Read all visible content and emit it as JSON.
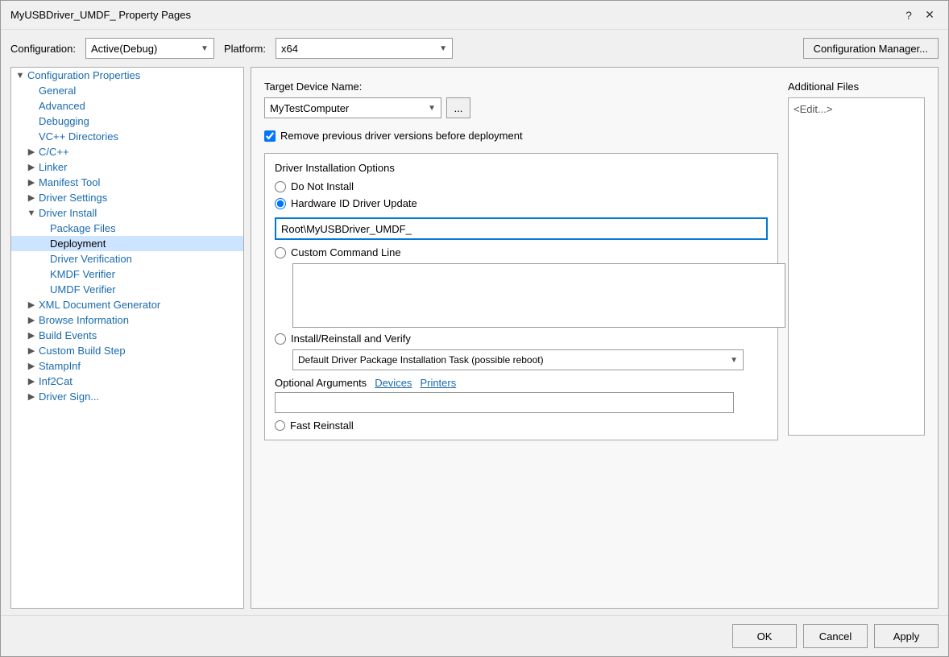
{
  "window": {
    "title": "MyUSBDriver_UMDF_ Property Pages",
    "help_btn": "?",
    "close_btn": "✕"
  },
  "config_bar": {
    "config_label": "Configuration:",
    "config_value": "Active(Debug)",
    "platform_label": "Platform:",
    "platform_value": "x64",
    "manager_btn": "Configuration Manager..."
  },
  "tree": {
    "items": [
      {
        "id": "config-props",
        "label": "Configuration Properties",
        "indent": 0,
        "expanded": true,
        "has_expand": true,
        "selected": false
      },
      {
        "id": "general",
        "label": "General",
        "indent": 1,
        "selected": false
      },
      {
        "id": "advanced",
        "label": "Advanced",
        "indent": 1,
        "selected": false
      },
      {
        "id": "debugging",
        "label": "Debugging",
        "indent": 1,
        "selected": false
      },
      {
        "id": "vc-dirs",
        "label": "VC++ Directories",
        "indent": 1,
        "selected": false
      },
      {
        "id": "cpp",
        "label": "C/C++",
        "indent": 1,
        "expanded": false,
        "has_expand": true,
        "selected": false
      },
      {
        "id": "linker",
        "label": "Linker",
        "indent": 1,
        "expanded": false,
        "has_expand": true,
        "selected": false
      },
      {
        "id": "manifest-tool",
        "label": "Manifest Tool",
        "indent": 1,
        "expanded": false,
        "has_expand": true,
        "selected": false
      },
      {
        "id": "driver-settings",
        "label": "Driver Settings",
        "indent": 1,
        "expanded": false,
        "has_expand": true,
        "selected": false
      },
      {
        "id": "driver-install",
        "label": "Driver Install",
        "indent": 1,
        "expanded": true,
        "has_expand": true,
        "selected": false
      },
      {
        "id": "package-files",
        "label": "Package Files",
        "indent": 2,
        "selected": false
      },
      {
        "id": "deployment",
        "label": "Deployment",
        "indent": 2,
        "selected": true
      },
      {
        "id": "driver-verification",
        "label": "Driver Verification",
        "indent": 2,
        "selected": false
      },
      {
        "id": "kmdf-verifier",
        "label": "KMDF Verifier",
        "indent": 2,
        "selected": false
      },
      {
        "id": "umdf-verifier",
        "label": "UMDF Verifier",
        "indent": 2,
        "selected": false
      },
      {
        "id": "xml-doc-gen",
        "label": "XML Document Generator",
        "indent": 1,
        "expanded": false,
        "has_expand": true,
        "selected": false
      },
      {
        "id": "browse-info",
        "label": "Browse Information",
        "indent": 1,
        "expanded": false,
        "has_expand": true,
        "selected": false
      },
      {
        "id": "build-events",
        "label": "Build Events",
        "indent": 1,
        "expanded": false,
        "has_expand": true,
        "selected": false
      },
      {
        "id": "custom-build",
        "label": "Custom Build Step",
        "indent": 1,
        "expanded": false,
        "has_expand": true,
        "selected": false
      },
      {
        "id": "stampinf",
        "label": "StampInf",
        "indent": 1,
        "expanded": false,
        "has_expand": true,
        "selected": false
      },
      {
        "id": "inf2cat",
        "label": "Inf2Cat",
        "indent": 1,
        "expanded": false,
        "has_expand": true,
        "selected": false
      },
      {
        "id": "driver-sign",
        "label": "Driver Sign...",
        "indent": 1,
        "expanded": false,
        "has_expand": true,
        "selected": false
      }
    ]
  },
  "content": {
    "target_device_label": "Target Device Name:",
    "target_device_value": "MyTestComputer",
    "browse_btn_label": "...",
    "remove_prev_label": "Remove previous driver versions before deployment",
    "remove_prev_checked": true,
    "driver_install_section": "Driver Installation Options",
    "do_not_install_label": "Do Not Install",
    "hw_id_label": "Hardware ID Driver Update",
    "hw_id_value": "Root\\MyUSBDriver_UMDF_",
    "custom_cmd_label": "Custom Command Line",
    "custom_cmd_value": "",
    "install_verify_label": "Install/Reinstall and Verify",
    "install_verify_option": "Default Driver Package Installation Task (possible reboot)",
    "optional_args_label": "Optional Arguments",
    "devices_link": "Devices",
    "printers_link": "Printers",
    "optional_args_value": "",
    "fast_reinstall_label": "Fast Reinstall",
    "additional_files_title": "Additional Files",
    "additional_files_placeholder": "<Edit...>"
  },
  "buttons": {
    "ok": "OK",
    "cancel": "Cancel",
    "apply": "Apply"
  }
}
